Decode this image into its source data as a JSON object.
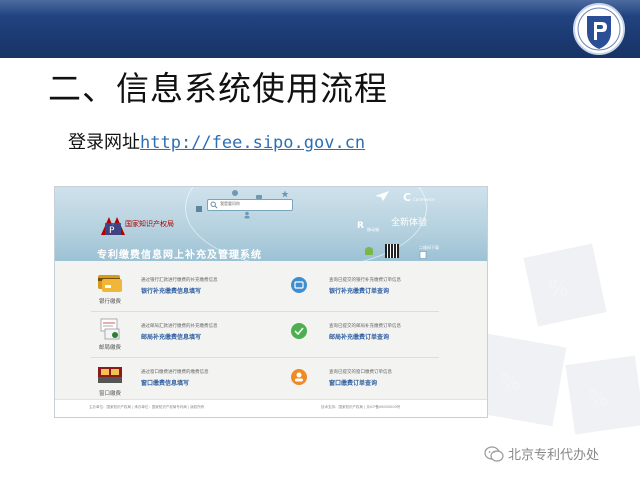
{
  "slide": {
    "title": "二、信息系统使用流程",
    "url_label": "登录网址",
    "url": "http://fee.sipo.gov.cn",
    "watermark": "北京专利代办处"
  },
  "colors": {
    "topbar": "#1c3b74",
    "link": "#2d6fb4",
    "banner": "#b4d0de",
    "brand_red": "#b30000"
  },
  "site": {
    "org_name": "国家知识产权局",
    "slogan": "专利缴费信息网上补充及管理系统",
    "search_text": "我是要问你",
    "c_sub": "Commerce",
    "new_experience": "全新体验",
    "r_sub": "移动端",
    "qr_label": "二维码下载",
    "rows": [
      {
        "caption": "银行缴费",
        "left_desc": "通过银行汇款进行缴费的补充缴费信息",
        "left_link": "银行补充缴费信息填写",
        "right_desc": "查询已提交的银行补充缴费订单信息",
        "right_link": "银行补充缴费订单查询",
        "icon": "bank-card-icon",
        "right_icon": "search-bank-icon"
      },
      {
        "caption": "邮局缴费",
        "left_desc": "通过邮局汇款进行缴费的补充缴费信息",
        "left_link": "邮局补充缴费信息填写",
        "right_desc": "查询已提交的邮局补充缴费订单信息",
        "right_link": "邮局补充缴费订单查询",
        "icon": "post-office-icon",
        "right_icon": "search-post-icon"
      },
      {
        "caption": "窗口缴费",
        "left_desc": "通过窗口缴费进行缴费的缴费信息",
        "left_link": "窗口缴费信息填写",
        "right_desc": "查询已提交的窗口缴费订单信息",
        "right_link": "窗口缴费订单查询",
        "icon": "counter-window-icon",
        "right_icon": "search-window-icon"
      }
    ],
    "footer_left": "主办单位：国家知识产权局 | 承办单位：国家知识产权局专利局 | 版权所有",
    "footer_right": "技术支持：国家知识产权局 | 京ICP备06000000号"
  }
}
